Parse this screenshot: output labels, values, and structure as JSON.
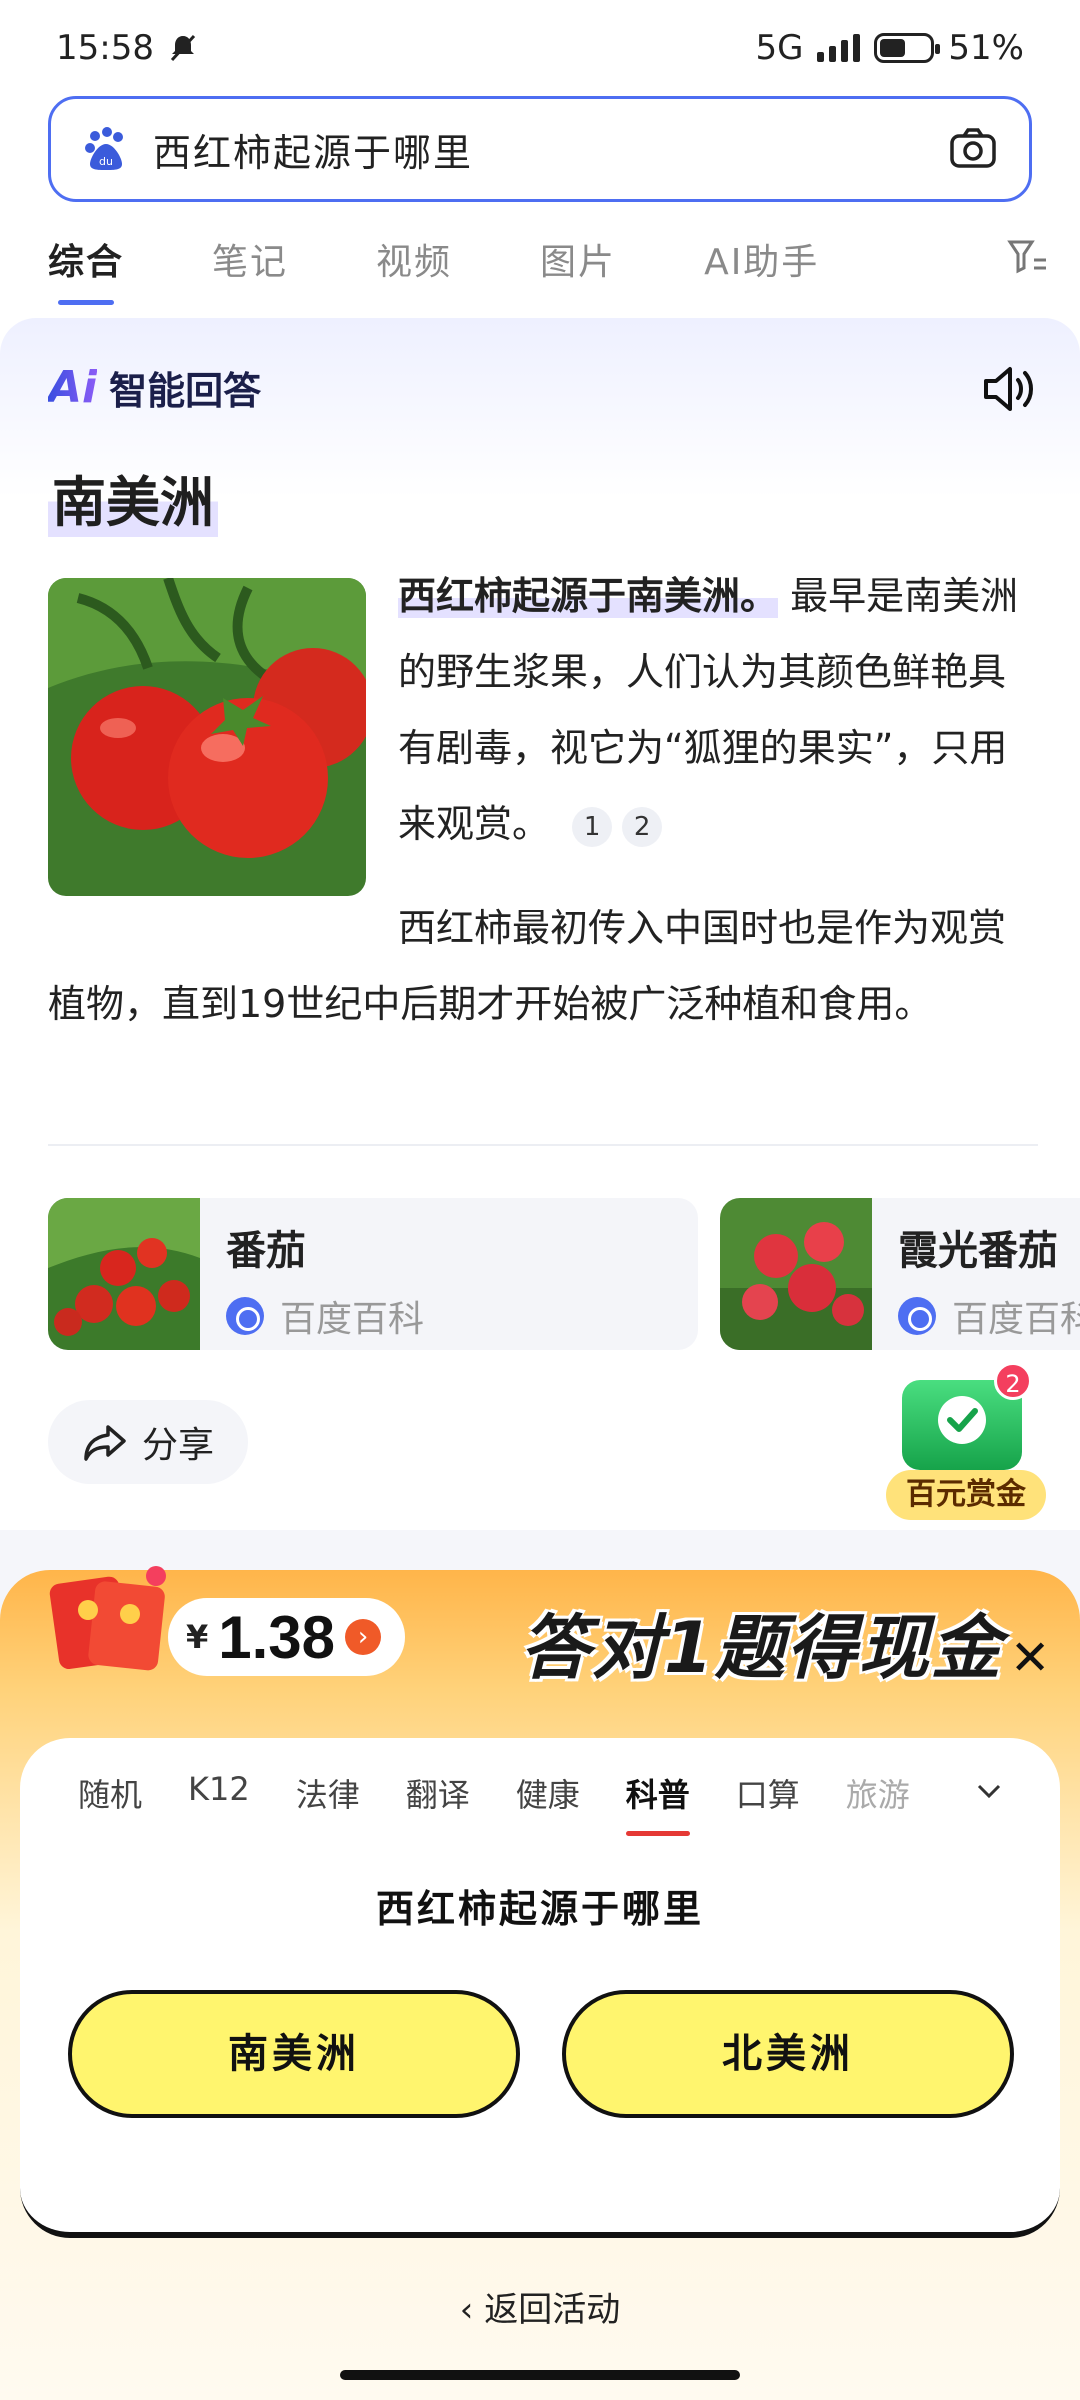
{
  "status_bar": {
    "time": "15:58",
    "network": "5G",
    "battery": "51%"
  },
  "search": {
    "query": "西红柿起源于哪里",
    "logo_icon": "baidu-paw-icon",
    "camera_icon": "camera-icon"
  },
  "tabs": [
    {
      "label": "综合",
      "active": true
    },
    {
      "label": "笔记",
      "active": false
    },
    {
      "label": "视频",
      "active": false
    },
    {
      "label": "图片",
      "active": false
    },
    {
      "label": "AI助手",
      "active": false
    }
  ],
  "ai_answer": {
    "logo": "Ai",
    "heading": "智能回答",
    "title": "南美洲",
    "para1_highlight": "西红柿起源于南美洲。",
    "para1_rest": "最早是南美洲的野生浆果，人们认为其颜色鲜艳具有剧毒，视它为“狐狸的果实”，只用来观赏。",
    "refs": [
      "1",
      "2"
    ],
    "para2": "西红柿最初传入中国时也是作为观赏植物，直到19世纪中后期才开始被广泛种植和食用。"
  },
  "entities": [
    {
      "name": "番茄",
      "source": "百度百科"
    },
    {
      "name": "霞光番茄",
      "source": "百度百科"
    }
  ],
  "share": {
    "label": "分享"
  },
  "reward": {
    "badge": "2",
    "label": "百元赏金"
  },
  "quiz": {
    "amount": "1.38",
    "currency": "¥",
    "title": "答对1题得现金",
    "close": "✕",
    "categories": [
      {
        "label": "随机",
        "active": false
      },
      {
        "label": "K12",
        "active": false
      },
      {
        "label": "法律",
        "active": false
      },
      {
        "label": "翻译",
        "active": false
      },
      {
        "label": "健康",
        "active": false
      },
      {
        "label": "科普",
        "active": true
      },
      {
        "label": "口算",
        "active": false
      },
      {
        "label": "旅游",
        "active": false
      }
    ],
    "question": "西红柿起源于哪里",
    "options": [
      "南美洲",
      "北美洲"
    ],
    "back_label": "返回活动"
  },
  "colors": {
    "accent": "#4e6ef2",
    "quiz_option": "#fff56e",
    "quiz_header": "#ffb54a"
  }
}
